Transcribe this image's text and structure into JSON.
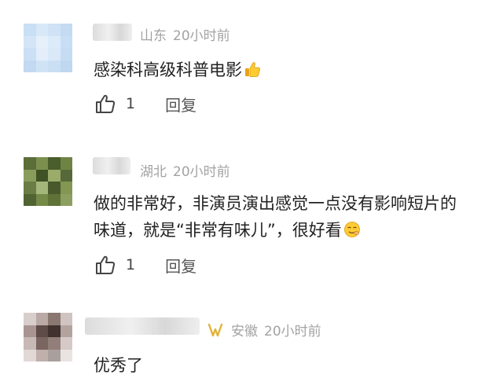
{
  "comments": [
    {
      "location": "山东",
      "time": "20小时前",
      "text": "感染科高级科普电影",
      "emoji": "thumbs-up-emoji",
      "likes": "1",
      "reply_label": "回复"
    },
    {
      "location": "湖北",
      "time": "20小时前",
      "text_line1": "做的非常好，非演员演出感觉一点没有影响短片的",
      "text_line2": "味道，就是“非常有味儿”，很好看",
      "emoji": "smug-face-emoji",
      "likes": "1",
      "reply_label": "回复"
    },
    {
      "location": "安徽",
      "time": "20小时前",
      "badge": "gold-badge-icon",
      "text": "优秀了"
    }
  ],
  "colors": {
    "meta": "#a3a3a3",
    "text": "#222222",
    "badge": "#e2b23a"
  }
}
